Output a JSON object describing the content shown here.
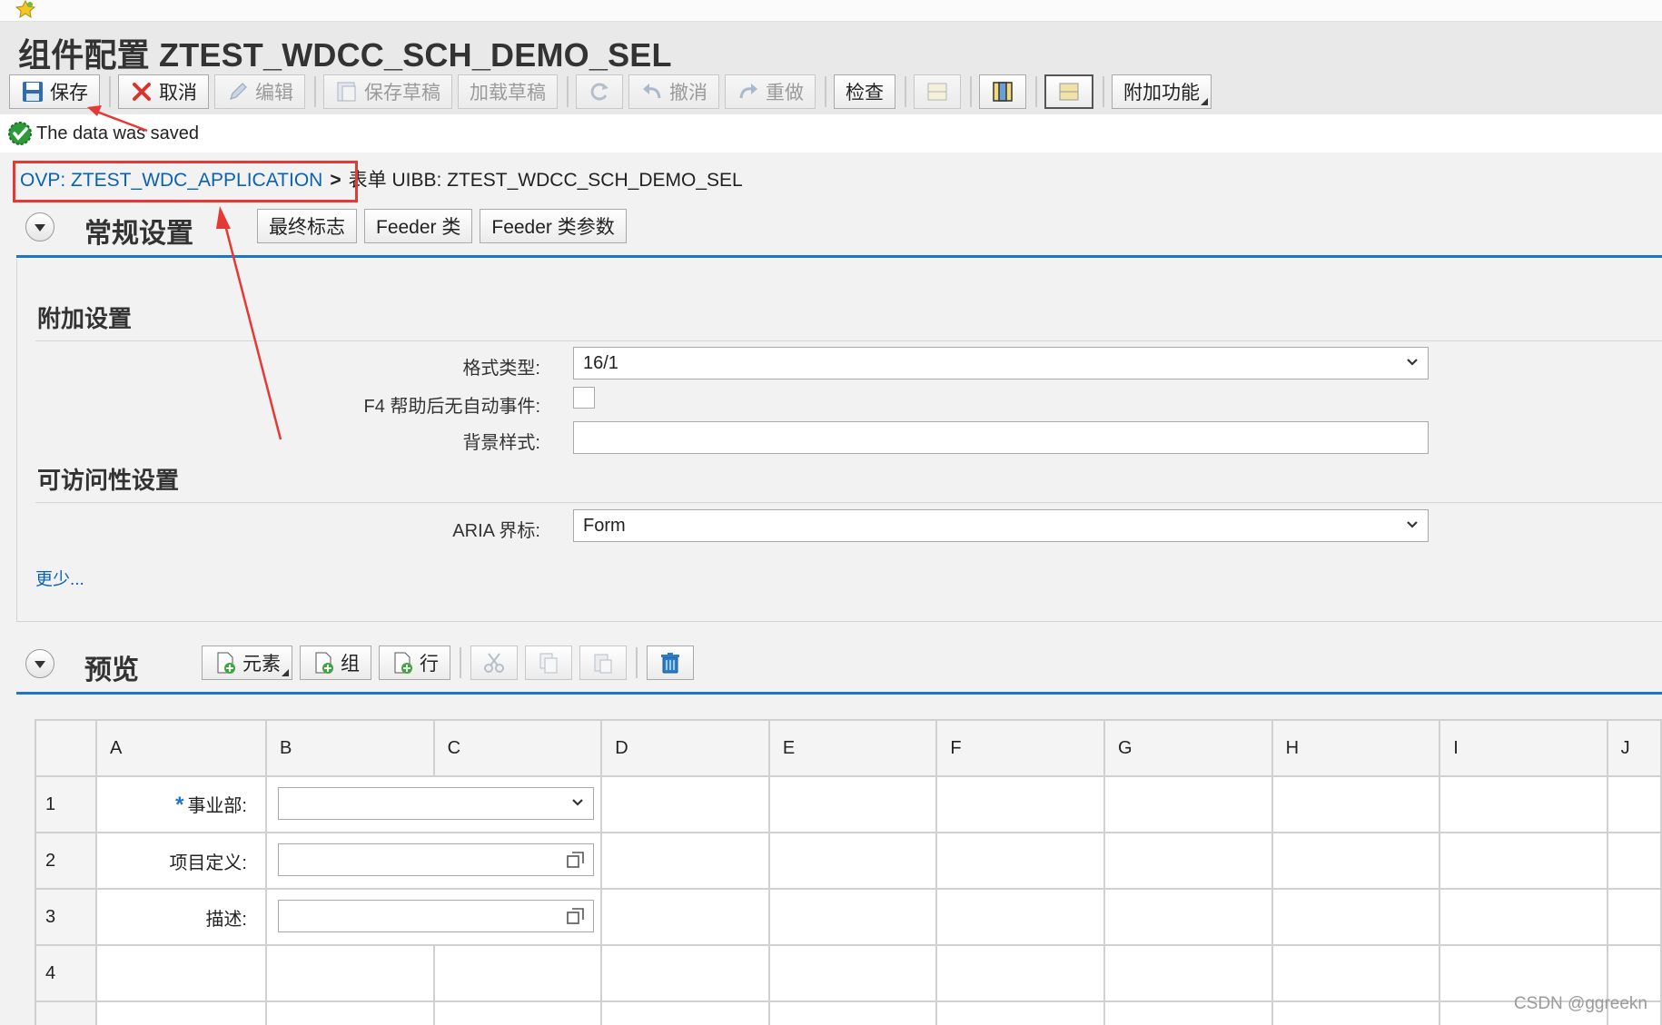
{
  "window": {
    "title": "组件配置 ZTEST_WDCC_SCH_DEMO_SEL"
  },
  "toolbar": {
    "save": "保存",
    "cancel": "取消",
    "edit": "编辑",
    "save_draft": "保存草稿",
    "load_draft": "加载草稿",
    "undo": "撤消",
    "redo": "重做",
    "check": "检查",
    "extra": "附加功能"
  },
  "message": {
    "text": "The data was saved"
  },
  "breadcrumb": {
    "parent": "OVP: ZTEST_WDC_APPLICATION",
    "separator": ">",
    "current": "表单 UIBB: ZTEST_WDCC_SCH_DEMO_SEL"
  },
  "general_settings": {
    "title": "常规设置",
    "buttons": [
      "最终标志",
      "Feeder 类",
      "Feeder 类参数"
    ]
  },
  "additional_settings": {
    "title": "附加设置",
    "format_type_label": "格式类型:",
    "format_type_value": "16/1",
    "f4_label": "F4 帮助后无自动事件:",
    "f4_checked": false,
    "background_label": "背景样式:",
    "background_value": ""
  },
  "accessibility": {
    "title": "可访问性设置",
    "aria_label": "ARIA 界标:",
    "aria_value": "Form",
    "less_link": "更少..."
  },
  "preview": {
    "title": "预览",
    "btn_element": "元素",
    "btn_group": "组",
    "btn_row": "行",
    "columns": [
      "A",
      "B",
      "C",
      "D",
      "E",
      "F",
      "G",
      "H",
      "I",
      "J"
    ],
    "rows": [
      {
        "num": "1",
        "label": "事业部:",
        "required": true,
        "field": "dropdown"
      },
      {
        "num": "2",
        "label": "项目定义:",
        "required": false,
        "field": "valuehelp"
      },
      {
        "num": "3",
        "label": "描述:",
        "required": false,
        "field": "valuehelp"
      },
      {
        "num": "4",
        "label": "",
        "required": false,
        "field": "none"
      }
    ],
    "required_marker": "*"
  },
  "watermark": "CSDN @ggreekn",
  "colors": {
    "accent": "#1c75c8",
    "link": "#0a62b3",
    "annotation": "#e53935"
  }
}
